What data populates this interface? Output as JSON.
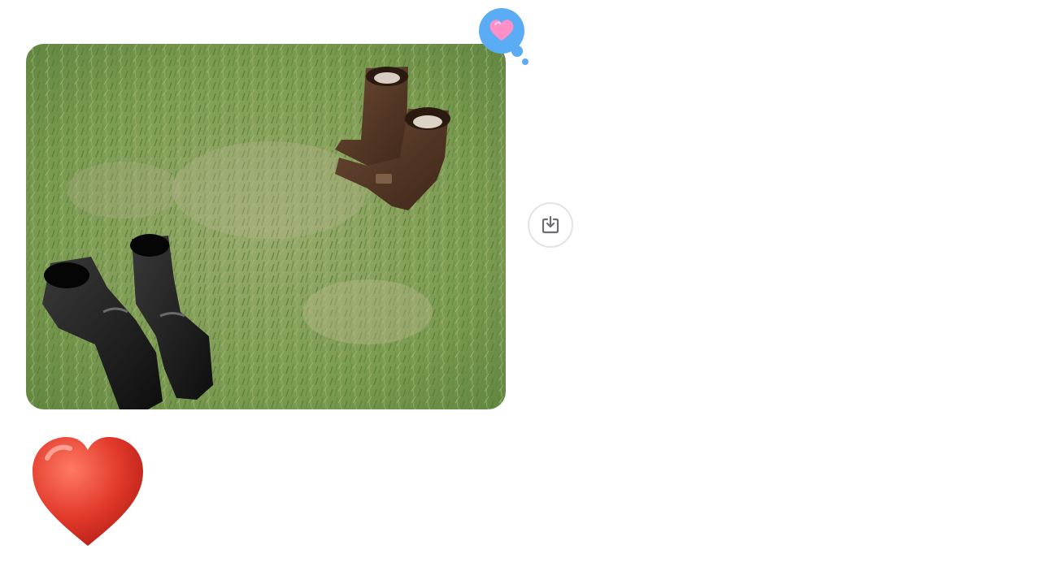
{
  "conversation": {
    "messages": [
      {
        "kind": "photo",
        "description_icon": "photo-attachment",
        "tapback": {
          "icon": "heart-icon",
          "bubble_color": "#5aacf5",
          "heart_color": "#ff8fc8"
        },
        "save_action": {
          "icon": "save-to-library-icon"
        }
      },
      {
        "kind": "emoji",
        "emoji_icon": "red-heart-icon",
        "emoji_color": "#e23a2b"
      }
    ]
  },
  "colors": {
    "grass": "#7c9a52",
    "save_button_border": "#e3e3e6",
    "save_icon": "#6e6e73"
  }
}
